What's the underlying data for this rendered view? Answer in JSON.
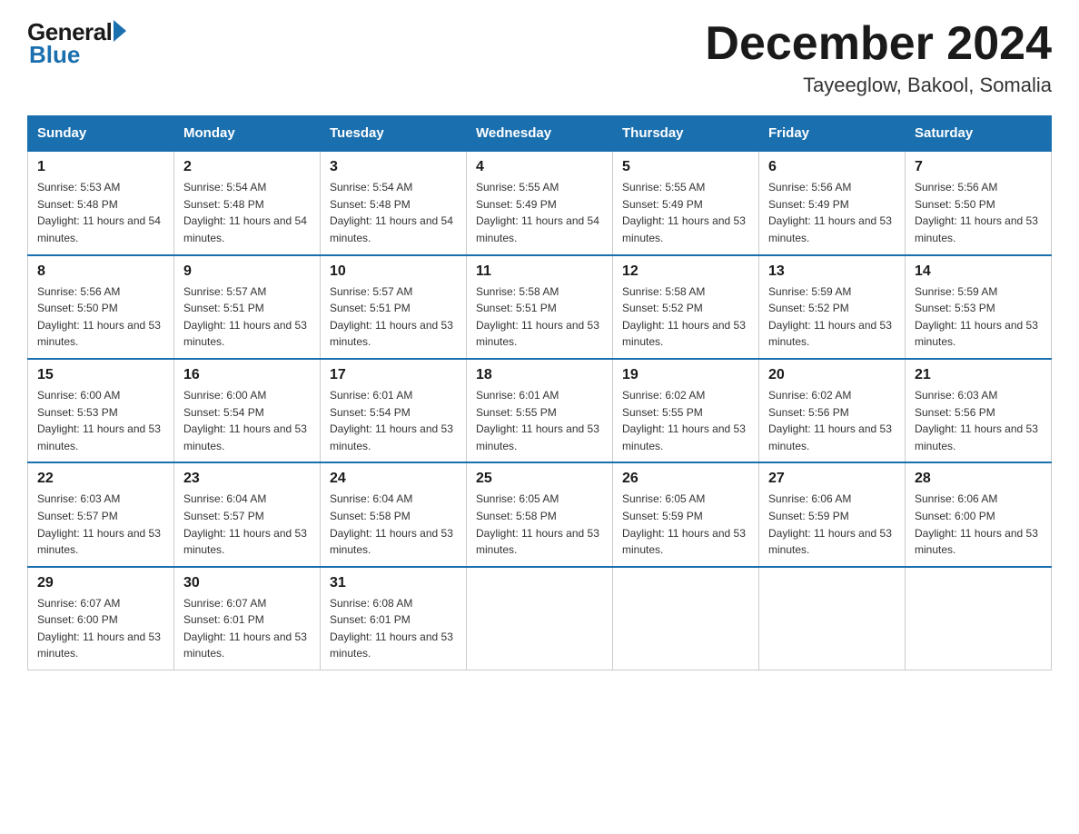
{
  "logo": {
    "general": "General",
    "blue": "Blue"
  },
  "title": "December 2024",
  "location": "Tayeeglow, Bakool, Somalia",
  "days_of_week": [
    "Sunday",
    "Monday",
    "Tuesday",
    "Wednesday",
    "Thursday",
    "Friday",
    "Saturday"
  ],
  "weeks": [
    [
      {
        "day": "1",
        "sunrise": "5:53 AM",
        "sunset": "5:48 PM",
        "daylight": "11 hours and 54 minutes."
      },
      {
        "day": "2",
        "sunrise": "5:54 AM",
        "sunset": "5:48 PM",
        "daylight": "11 hours and 54 minutes."
      },
      {
        "day": "3",
        "sunrise": "5:54 AM",
        "sunset": "5:48 PM",
        "daylight": "11 hours and 54 minutes."
      },
      {
        "day": "4",
        "sunrise": "5:55 AM",
        "sunset": "5:49 PM",
        "daylight": "11 hours and 54 minutes."
      },
      {
        "day": "5",
        "sunrise": "5:55 AM",
        "sunset": "5:49 PM",
        "daylight": "11 hours and 53 minutes."
      },
      {
        "day": "6",
        "sunrise": "5:56 AM",
        "sunset": "5:49 PM",
        "daylight": "11 hours and 53 minutes."
      },
      {
        "day": "7",
        "sunrise": "5:56 AM",
        "sunset": "5:50 PM",
        "daylight": "11 hours and 53 minutes."
      }
    ],
    [
      {
        "day": "8",
        "sunrise": "5:56 AM",
        "sunset": "5:50 PM",
        "daylight": "11 hours and 53 minutes."
      },
      {
        "day": "9",
        "sunrise": "5:57 AM",
        "sunset": "5:51 PM",
        "daylight": "11 hours and 53 minutes."
      },
      {
        "day": "10",
        "sunrise": "5:57 AM",
        "sunset": "5:51 PM",
        "daylight": "11 hours and 53 minutes."
      },
      {
        "day": "11",
        "sunrise": "5:58 AM",
        "sunset": "5:51 PM",
        "daylight": "11 hours and 53 minutes."
      },
      {
        "day": "12",
        "sunrise": "5:58 AM",
        "sunset": "5:52 PM",
        "daylight": "11 hours and 53 minutes."
      },
      {
        "day": "13",
        "sunrise": "5:59 AM",
        "sunset": "5:52 PM",
        "daylight": "11 hours and 53 minutes."
      },
      {
        "day": "14",
        "sunrise": "5:59 AM",
        "sunset": "5:53 PM",
        "daylight": "11 hours and 53 minutes."
      }
    ],
    [
      {
        "day": "15",
        "sunrise": "6:00 AM",
        "sunset": "5:53 PM",
        "daylight": "11 hours and 53 minutes."
      },
      {
        "day": "16",
        "sunrise": "6:00 AM",
        "sunset": "5:54 PM",
        "daylight": "11 hours and 53 minutes."
      },
      {
        "day": "17",
        "sunrise": "6:01 AM",
        "sunset": "5:54 PM",
        "daylight": "11 hours and 53 minutes."
      },
      {
        "day": "18",
        "sunrise": "6:01 AM",
        "sunset": "5:55 PM",
        "daylight": "11 hours and 53 minutes."
      },
      {
        "day": "19",
        "sunrise": "6:02 AM",
        "sunset": "5:55 PM",
        "daylight": "11 hours and 53 minutes."
      },
      {
        "day": "20",
        "sunrise": "6:02 AM",
        "sunset": "5:56 PM",
        "daylight": "11 hours and 53 minutes."
      },
      {
        "day": "21",
        "sunrise": "6:03 AM",
        "sunset": "5:56 PM",
        "daylight": "11 hours and 53 minutes."
      }
    ],
    [
      {
        "day": "22",
        "sunrise": "6:03 AM",
        "sunset": "5:57 PM",
        "daylight": "11 hours and 53 minutes."
      },
      {
        "day": "23",
        "sunrise": "6:04 AM",
        "sunset": "5:57 PM",
        "daylight": "11 hours and 53 minutes."
      },
      {
        "day": "24",
        "sunrise": "6:04 AM",
        "sunset": "5:58 PM",
        "daylight": "11 hours and 53 minutes."
      },
      {
        "day": "25",
        "sunrise": "6:05 AM",
        "sunset": "5:58 PM",
        "daylight": "11 hours and 53 minutes."
      },
      {
        "day": "26",
        "sunrise": "6:05 AM",
        "sunset": "5:59 PM",
        "daylight": "11 hours and 53 minutes."
      },
      {
        "day": "27",
        "sunrise": "6:06 AM",
        "sunset": "5:59 PM",
        "daylight": "11 hours and 53 minutes."
      },
      {
        "day": "28",
        "sunrise": "6:06 AM",
        "sunset": "6:00 PM",
        "daylight": "11 hours and 53 minutes."
      }
    ],
    [
      {
        "day": "29",
        "sunrise": "6:07 AM",
        "sunset": "6:00 PM",
        "daylight": "11 hours and 53 minutes."
      },
      {
        "day": "30",
        "sunrise": "6:07 AM",
        "sunset": "6:01 PM",
        "daylight": "11 hours and 53 minutes."
      },
      {
        "day": "31",
        "sunrise": "6:08 AM",
        "sunset": "6:01 PM",
        "daylight": "11 hours and 53 minutes."
      },
      null,
      null,
      null,
      null
    ]
  ]
}
